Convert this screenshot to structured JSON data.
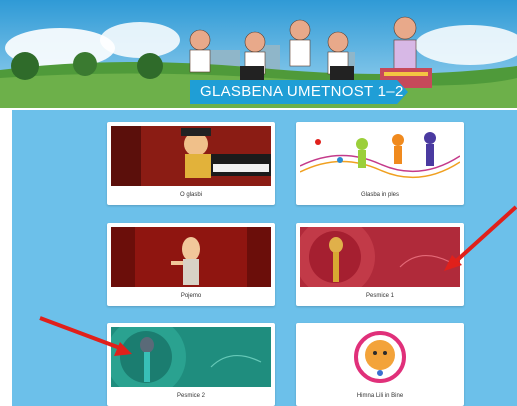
{
  "banner": {
    "title": "GLASBENA UMETNOST 1–2"
  },
  "cards": [
    {
      "label": "O glasbi",
      "icon": "piano-player-illustration"
    },
    {
      "label": "Glasba in ples",
      "icon": "dancers-music-notes-illustration"
    },
    {
      "label": "Pojemo",
      "icon": "singer-illustration"
    },
    {
      "label": "Pesmice 1",
      "icon": "microphone-icon"
    },
    {
      "label": "Pesmice 2",
      "icon": "microphone-icon"
    },
    {
      "label": "Himna Lili in Bine",
      "icon": "lili-bine-badge"
    }
  ],
  "colors": {
    "background": "#6cc0ea",
    "banner_label": "#1f9ed6",
    "arrow": "#e0201b"
  }
}
